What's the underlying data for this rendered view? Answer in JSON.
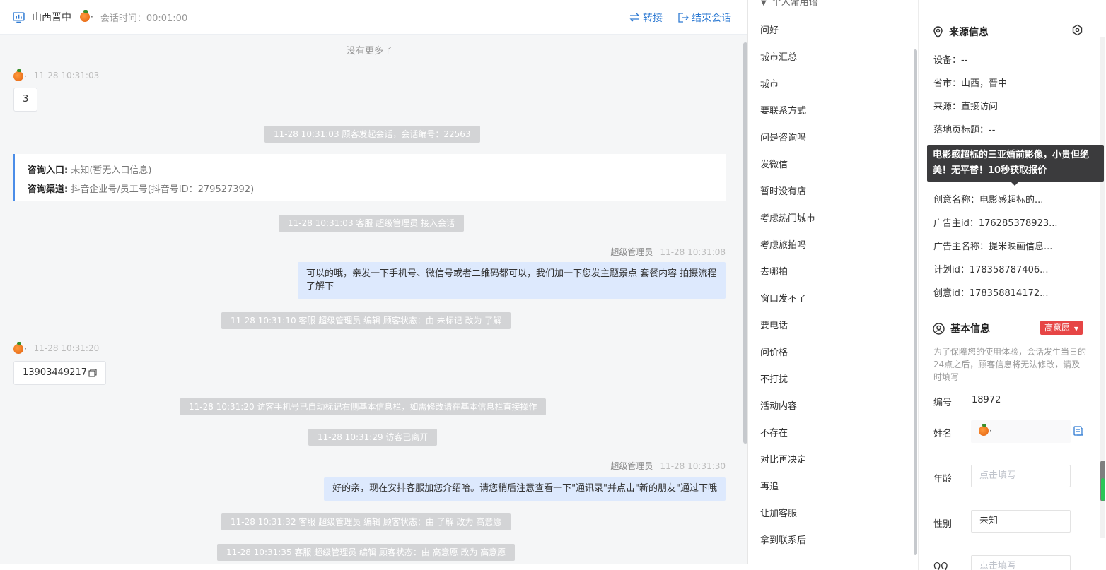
{
  "header": {
    "customer_name": "山西晋中",
    "session_time": "会话时间：00:01:00",
    "transfer_label": "转接",
    "end_label": "结束会话"
  },
  "chat": {
    "no_more": "没有更多了",
    "msg1_time": "11-28 10:31:03",
    "msg1_text": "3",
    "sys1": "11-28 10:31:03 顾客发起会话，会话编号：22563",
    "info_entry_label": "咨询入口:",
    "info_entry_value": "未知(暂无入口信息)",
    "info_channel_label": "咨询渠道:",
    "info_channel_value": "抖音企业号/员工号(抖音号ID：279527392)",
    "sys2": "11-28 10:31:03 客服 超级管理员 接入会话",
    "agent_name": "超级管理员",
    "msg2_time": "11-28 10:31:08",
    "msg2_text": "可以的哦，亲发一下手机号、微信号或者二维码都可以，我们加一下您发主题景点 套餐内容 拍摄流程了解下",
    "sys3": "11-28 10:31:10 客服 超级管理员 编辑 顾客状态：由 未标记 改为 了解",
    "msg3_time": "11-28 10:31:20",
    "msg3_text": "13903449217",
    "sys4": "11-28 10:31:20 访客手机号已自动标记右侧基本信息栏，如需修改请在基本信息栏直接操作",
    "sys5": "11-28 10:31:29 访客已离开",
    "msg4_time": "11-28 10:31:30",
    "msg4_text": "好的亲，现在安排客服加您介绍哈。请您稍后注意查看一下\"通讯录\"并点击\"新的朋友\"通过下哦",
    "sys6": "11-28 10:31:32 客服 超级管理员 编辑 顾客状态：由 了解 改为 高意愿",
    "sys7": "11-28 10:31:35 客服 超级管理员 编辑 顾客状态：由 高意愿 改为 高意愿"
  },
  "quick_replies": {
    "group_title": "个人常用语",
    "items": [
      "问好",
      "城市汇总",
      "城市",
      "要联系方式",
      "问是咨询吗",
      "发微信",
      "暂时没有店",
      "考虑热门城市",
      "考虑旅拍吗",
      "去哪拍",
      "窗口发不了",
      "要电话",
      "问价格",
      "不打扰",
      "活动内容",
      "不存在",
      "对比再决定",
      "再追",
      "让加客服",
      "拿到联系后"
    ]
  },
  "source_info": {
    "title": "来源信息",
    "device": "设备：--",
    "province": "省市：山西，晋中",
    "source": "来源：直接访问",
    "landing_title": "落地页标题：--",
    "tooltip": "电影感超标的三亚婚前影像，小贵但绝美！无平替！10秒获取报价",
    "creative_name": "创意名称：电影感超标的...",
    "advertiser_id": "广告主id：176285378923...",
    "advertiser_name": "广告主名称：提米映画信息...",
    "plan_id": "计划id：178358787406...",
    "creative_id": "创意id：178358814172..."
  },
  "basic_info": {
    "title": "基本信息",
    "intent": "高意愿",
    "notice": "为了保障您的使用体验，会话发生当日的24点之后，顾客信息将无法修改，请及时填写",
    "number_label": "编号",
    "number_value": "18972",
    "name_label": "姓名",
    "age_label": "年龄",
    "age_placeholder": "点击填写",
    "gender_label": "性别",
    "gender_value": "未知",
    "qq_label": "QQ",
    "qq_placeholder": "点击填写"
  },
  "colors": {
    "accent": "#2f7bd3",
    "agent_bubble": "#dde9fd",
    "system_pill": "#d3d4d6",
    "intent_badge": "#e64545"
  }
}
